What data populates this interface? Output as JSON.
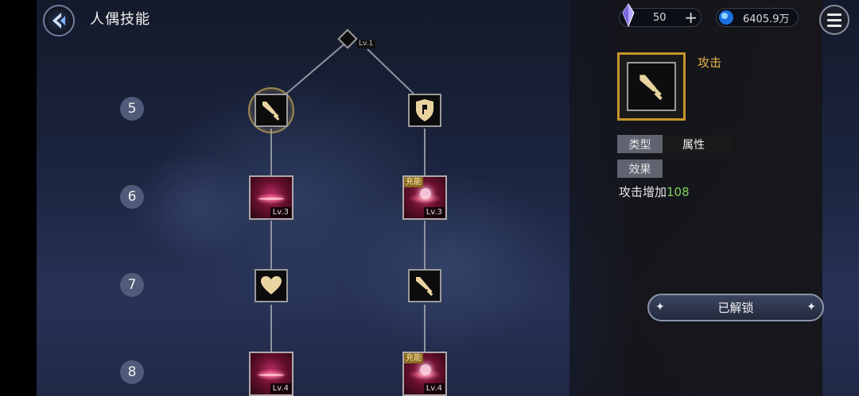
{
  "header": {
    "title": "人偶技能",
    "crystal_count": "50",
    "gold_count": "6405.9万"
  },
  "tree": {
    "top_node_lv": "Lv.1",
    "rows": [
      "5",
      "6",
      "7",
      "8"
    ],
    "row6_left_lv": "Lv.3",
    "row6_right_lv": "Lv.3",
    "row6_right_badge": "充能",
    "row8_left_lv": "Lv.4",
    "row8_right_lv": "Lv.4",
    "row8_right_badge": "充能"
  },
  "detail": {
    "name": "攻击",
    "type_label": "类型",
    "type_value": "属性",
    "effect_label": "效果",
    "effect_prefix": "攻击增加",
    "effect_value": "108",
    "unlock_button": "已解锁"
  },
  "colors": {
    "accent_gold": "#c8942c",
    "effect_green": "#7fd25a",
    "row_badge": "#4f5b78"
  },
  "icons": {
    "back": "back-arrow-icon",
    "crystal": "crystal-icon",
    "gold": "blue-orb-icon",
    "menu": "menu-icon",
    "sword": "dagger-icon",
    "shield": "shield-icon",
    "heart": "heart-icon"
  }
}
